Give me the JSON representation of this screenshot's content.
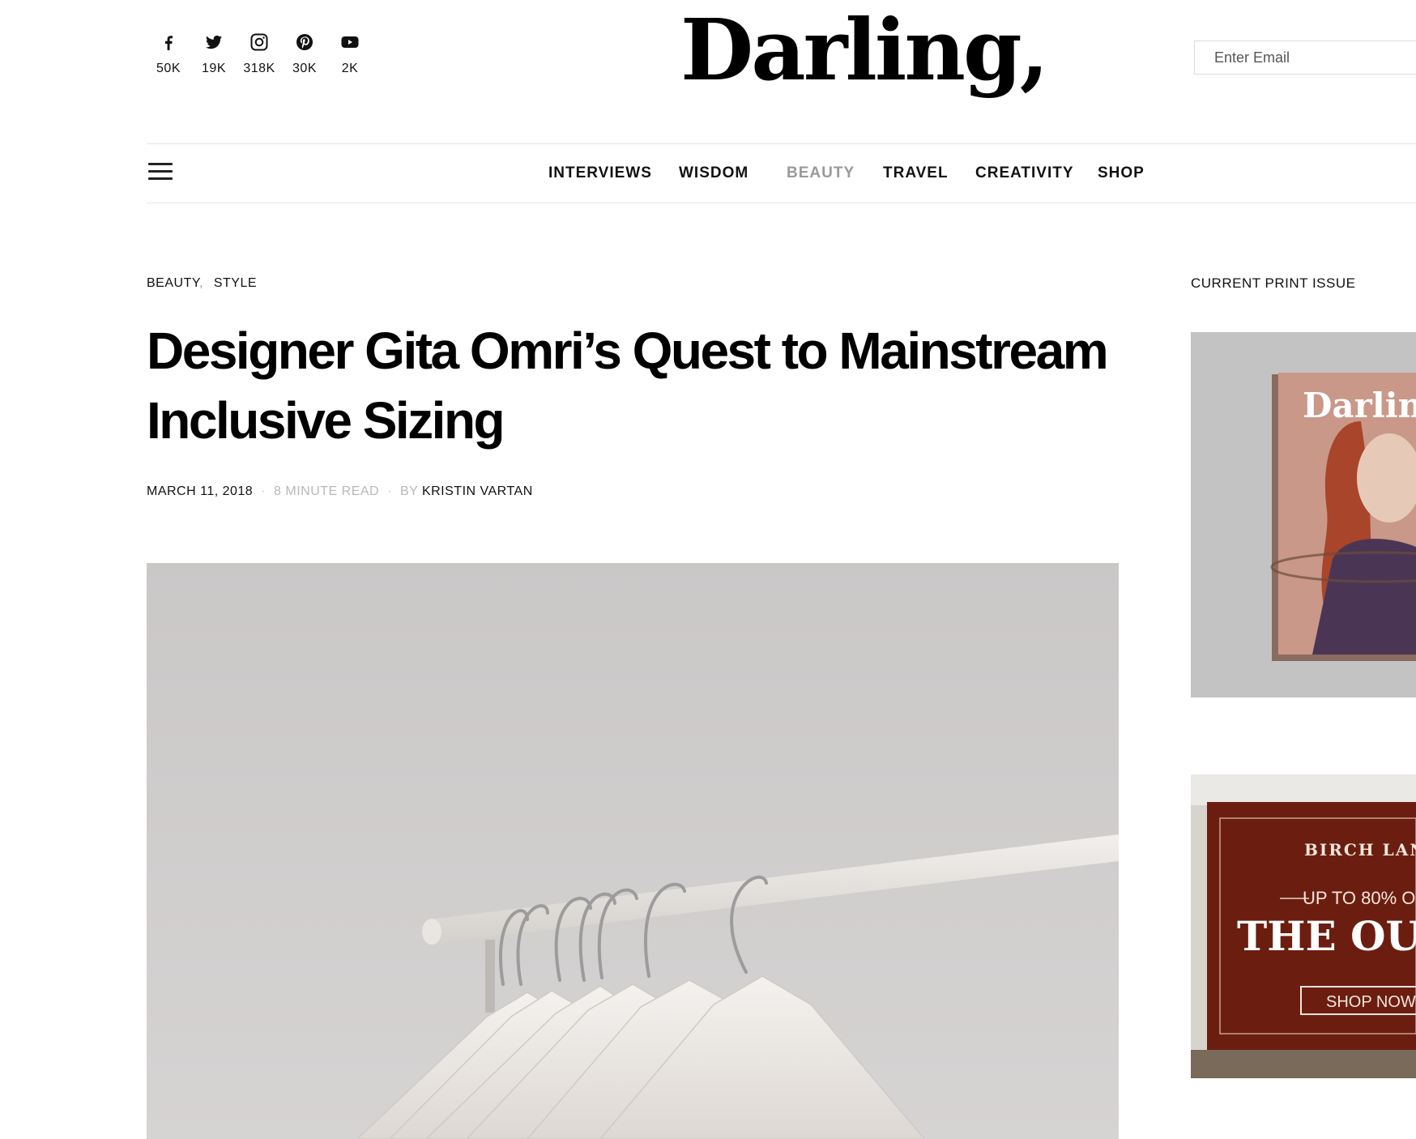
{
  "social": [
    {
      "icon": "facebook-icon",
      "count": "50K"
    },
    {
      "icon": "twitter-icon",
      "count": "19K"
    },
    {
      "icon": "instagram-icon",
      "count": "318K"
    },
    {
      "icon": "pinterest-icon",
      "count": "30K"
    },
    {
      "icon": "youtube-icon",
      "count": "2K"
    }
  ],
  "header": {
    "logo": "Darling,",
    "email_placeholder": "Enter Email"
  },
  "nav": {
    "items": [
      {
        "label": "INTERVIEWS",
        "active": false
      },
      {
        "label": "WISDOM",
        "active": false
      },
      {
        "label": "BEAUTY",
        "active": true
      },
      {
        "label": "TRAVEL",
        "active": false
      },
      {
        "label": "CREATIVITY",
        "active": false
      },
      {
        "label": "SHOP",
        "active": false
      }
    ],
    "active_color": "#9a9a9a"
  },
  "article": {
    "categories": [
      "BEAUTY",
      "STYLE"
    ],
    "category_separator": ",",
    "title": "Designer Gita Omri’s Quest to Mainstream Inclusive Sizing",
    "date": "MARCH 11, 2018",
    "read_time": "8 MINUTE READ",
    "by_label": "BY",
    "author": "KRISTIN VARTAN"
  },
  "sidebar": {
    "print_issue_title": "CURRENT PRINT ISSUE",
    "magazine_cover_text": "Darling",
    "ad": {
      "brand": "BIRCH LAN",
      "offer": "UP TO 80% O",
      "headline": "THE OUT",
      "cta": "SHOP NOW",
      "bg_color": "#6b1e10"
    }
  },
  "colors": {
    "text": "#111111",
    "muted": "#b8b8b8",
    "rule": "#e6e6e6",
    "hero_bg": "#cfcccc"
  }
}
